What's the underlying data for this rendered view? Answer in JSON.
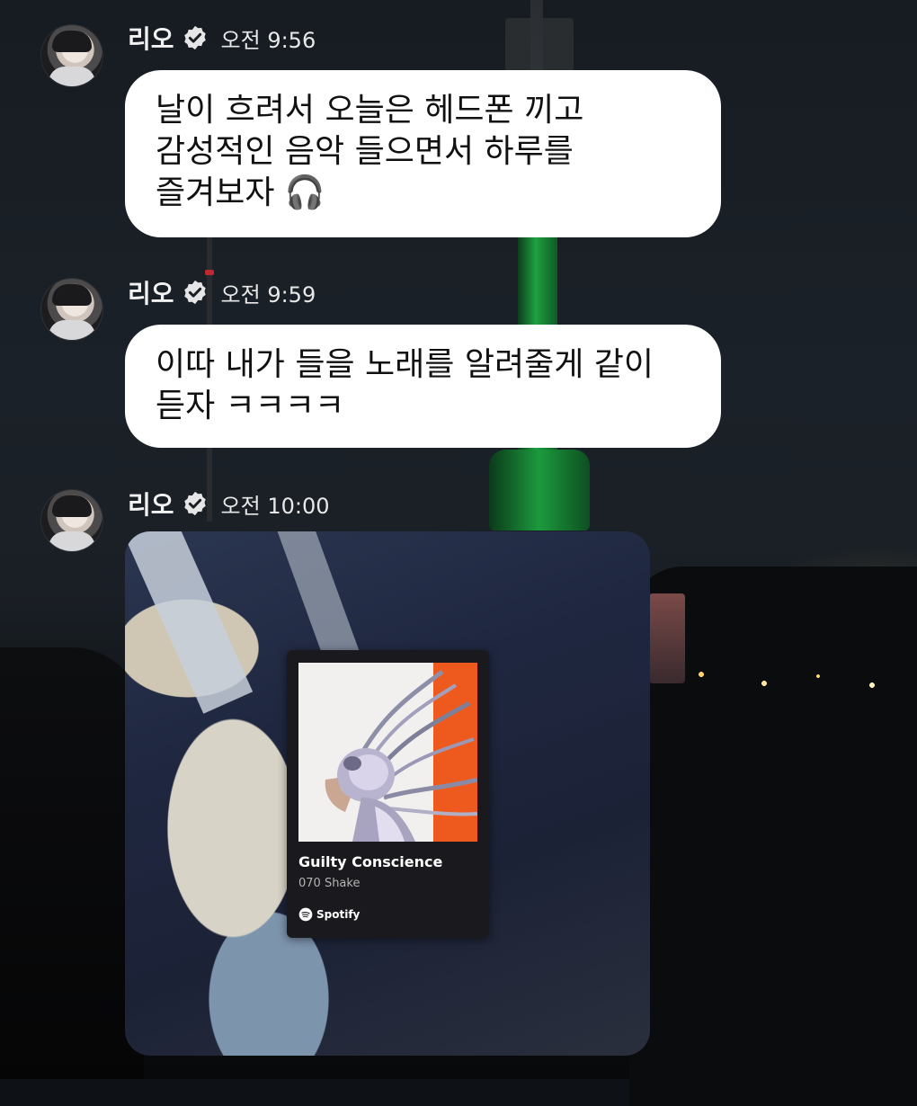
{
  "messages": [
    {
      "sender": "리오",
      "time": "오전 9:56",
      "lines": [
        "날이 흐려서 오늘은 헤드폰 끼고",
        "감성적인 음악 들으면서 하루를",
        "즐겨보자 🎧"
      ]
    },
    {
      "sender": "리오",
      "time": "오전 9:59",
      "lines": [
        "이따 내가 들을 노래를 알려줄게 같이",
        "듣자 ㅋㅋㅋㅋ"
      ]
    },
    {
      "sender": "리오",
      "time": "오전 10:00",
      "attachment": {
        "type": "spotify-share",
        "track_title": "Guilty Conscience",
        "artist": "070 Shake",
        "brand": "Spotify"
      }
    }
  ],
  "icons": {
    "verified": "verified-badge-icon",
    "spotify": "spotify-logo-icon"
  },
  "colors": {
    "bubble": "#ffffff",
    "text_dark": "#111111",
    "name_text": "#f2f2f2",
    "spotify_green": "#1ed760",
    "album_orange": "#ee5a1e"
  }
}
